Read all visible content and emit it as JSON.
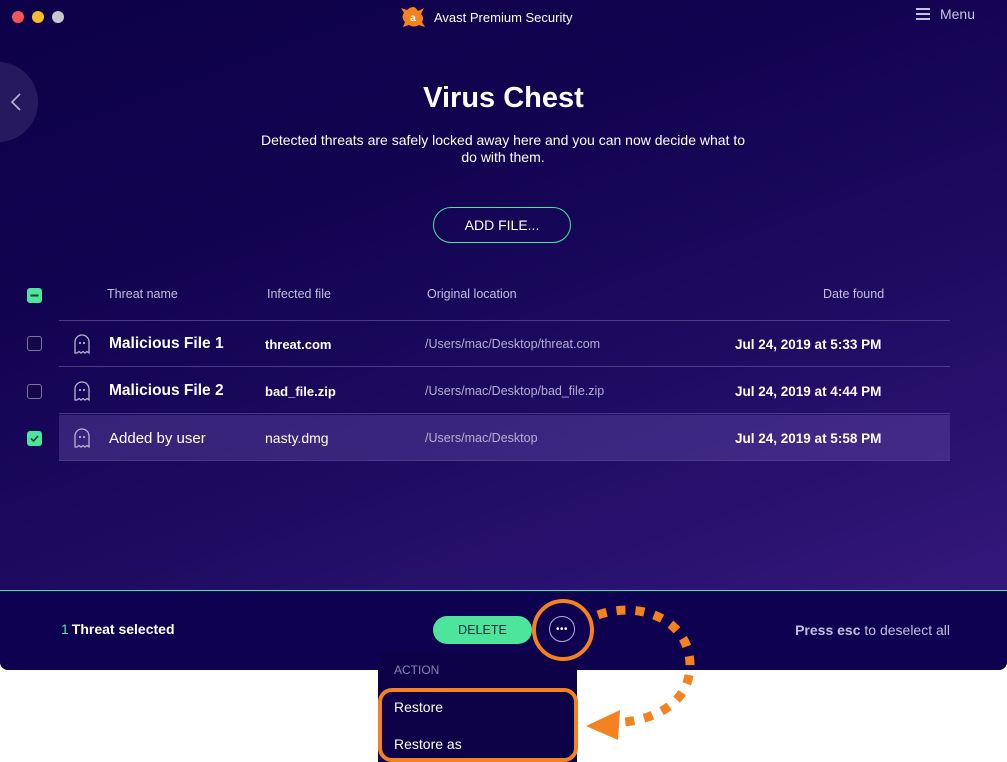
{
  "window": {
    "app_title": "Avast Premium Security",
    "menu_label": "Menu",
    "icons": {
      "app_logo": "avast-logo-icon",
      "menu": "hamburger-icon",
      "back": "chevron-left-icon"
    }
  },
  "page": {
    "title": "Virus Chest",
    "description": "Detected threats are safely locked away here and you can now decide what to do with them.",
    "add_file_label": "ADD FILE..."
  },
  "table": {
    "columns": [
      "Threat name",
      "Infected file",
      "Original location",
      "Date found"
    ],
    "select_all_state": "mixed",
    "rows": [
      {
        "name": "Malicious File 1",
        "file": "threat.com",
        "location": "/Users/mac/Desktop/threat.com",
        "date": "Jul 24, 2019 at 5:33 PM",
        "checked": false,
        "icon": "ghost-icon"
      },
      {
        "name": "Malicious File 2",
        "file": "bad_file.zip",
        "location": "/Users/mac/Desktop/bad_file.zip",
        "date": "Jul 24, 2019 at 4:44 PM",
        "checked": false,
        "icon": "ghost-icon"
      },
      {
        "name": "Added by user",
        "file": "nasty.dmg",
        "location": "/Users/mac/Desktop",
        "date": "Jul 24, 2019 at 5:58 PM",
        "checked": true,
        "icon": "ghost-icon"
      }
    ]
  },
  "bottom_bar": {
    "selected_count": "1",
    "selected_label": "Threat selected",
    "delete_label": "DELETE",
    "more_label": "•••",
    "esc_hint_bold": "Press esc",
    "esc_hint_rest": " to deselect all"
  },
  "action_menu": {
    "header": "ACTION",
    "items": [
      "Restore",
      "Restore as"
    ]
  },
  "colors": {
    "accent_green": "#4ce59b",
    "annotation_orange": "#f58220",
    "background_dark": "#0d0148"
  }
}
